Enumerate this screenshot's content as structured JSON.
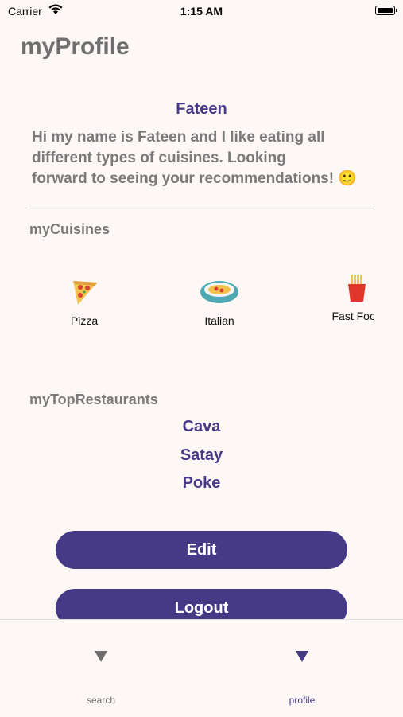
{
  "status_bar": {
    "carrier": "Carrier",
    "time": "1:15 AM"
  },
  "header": {
    "title": "myProfile"
  },
  "profile": {
    "name": "Fateen",
    "bio_lines": [
      "Hi my name is Fateen and I like eating all",
      "different types of cuisines. Looking",
      "forward to seeing your recommendations! 🙂"
    ]
  },
  "cuisines": {
    "title": "myCuisines",
    "items": [
      {
        "label": "Pizza",
        "icon": "pizza-icon"
      },
      {
        "label": "Italian",
        "icon": "pasta-bowl-icon"
      },
      {
        "label": "Fast Food",
        "icon": "fries-icon"
      }
    ]
  },
  "restaurants": {
    "title": "myTopRestaurants",
    "items": [
      "Cava",
      "Satay",
      "Poke"
    ]
  },
  "buttons": {
    "edit": "Edit",
    "logout": "Logout"
  },
  "tab_bar": {
    "items": [
      {
        "label": "search",
        "icon": "triangle-down-icon",
        "active": false
      },
      {
        "label": "profile",
        "icon": "triangle-down-icon",
        "active": true
      }
    ],
    "active_color": "#463a86",
    "inactive_color": "#6e6e6e"
  },
  "colors": {
    "accent": "#463a86",
    "background": "#fdf7f6",
    "muted_text": "#7a7a7a"
  }
}
